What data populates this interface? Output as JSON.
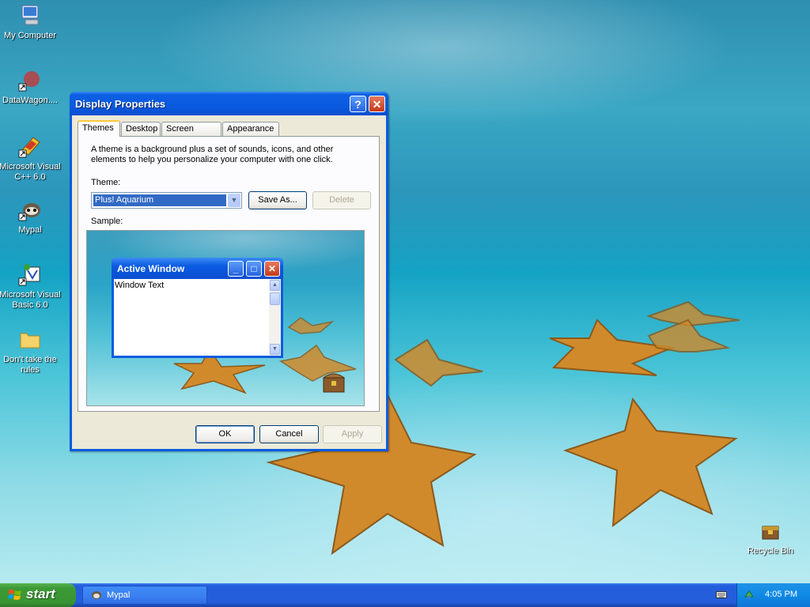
{
  "desktop": {
    "icons": [
      {
        "label": "My Computer"
      },
      {
        "label": "DataWagon...."
      },
      {
        "label": "Microsoft Visual C++ 6.0"
      },
      {
        "label": "Mypal"
      },
      {
        "label": "Microsoft Visual Basic 6.0"
      },
      {
        "label": "Don't take the rules"
      },
      {
        "label": "Recycle Bin"
      }
    ]
  },
  "dialog": {
    "title": "Display Properties",
    "help_label": "?",
    "close_label": "✕",
    "tabs": [
      {
        "label": "Themes"
      },
      {
        "label": "Desktop"
      },
      {
        "label": "Screen Saver"
      },
      {
        "label": "Appearance"
      }
    ],
    "description": "A theme is a background plus a set of sounds, icons, and other elements to help you personalize your computer with one click.",
    "theme_label": "Theme:",
    "theme_value": "Plus! Aquarium",
    "save_as_label": "Save As...",
    "delete_label": "Delete",
    "sample_label": "Sample:",
    "sample_window": {
      "title": "Active Window",
      "text": "Window Text"
    },
    "ok_label": "OK",
    "cancel_label": "Cancel",
    "apply_label": "Apply"
  },
  "taskbar": {
    "start_label": "start",
    "task_label": "Mypal",
    "clock": "4:05 PM"
  }
}
